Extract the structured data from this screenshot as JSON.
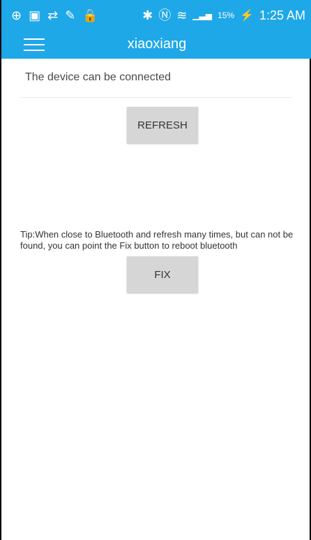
{
  "status_bar": {
    "battery_percent": "15%",
    "time": "1:25 AM",
    "icons_left": [
      "plus-icon",
      "image-icon",
      "sync-icon",
      "edit-icon",
      "lock-warning-icon"
    ],
    "icons_right": [
      "bluetooth-icon",
      "nfc-icon",
      "vibrate-icon",
      "signal-icon",
      "battery-icon"
    ],
    "accent": "#1ea8e8"
  },
  "toolbar": {
    "title": "xiaoxiang",
    "menu_icon": "hamburger-icon"
  },
  "main": {
    "connect_text": "The device can be connected",
    "refresh_label": "REFRESH",
    "tip": "Tip:When close to Bluetooth and refresh many times, but can not be found, you can point the Fix button to reboot bluetooth",
    "fix_label": "FIX"
  }
}
